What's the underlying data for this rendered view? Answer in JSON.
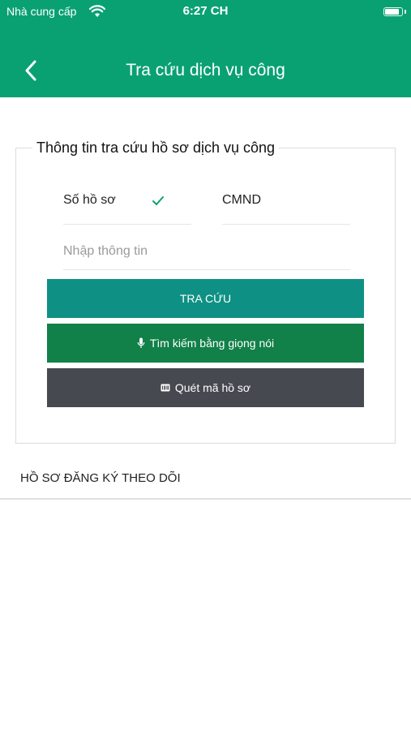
{
  "status_bar": {
    "carrier": "Nhà cung cấp",
    "time": "6:27 CH",
    "battery_level": 0.85
  },
  "header": {
    "title": "Tra cứu dịch vụ công",
    "back_icon": "chevron-left-icon",
    "background_color": "#0aa172"
  },
  "search_card": {
    "legend": "Thông tin tra cứu hồ sơ dịch vụ công",
    "tabs": [
      {
        "label": "Số hồ sơ",
        "selected": true
      },
      {
        "label": "CMND",
        "selected": false
      }
    ],
    "input": {
      "placeholder": "Nhập thông tin",
      "value": ""
    },
    "buttons": {
      "search": {
        "label": "TRA CỨU",
        "color": "#0e9184"
      },
      "voice": {
        "label": "Tìm kiếm bằng giọng nói",
        "icon": "microphone-icon",
        "color": "#118049"
      },
      "scan": {
        "label": "Quét mã hồ sơ",
        "icon": "barcode-icon",
        "color": "#464950"
      }
    }
  },
  "tracked_section": {
    "title": "HỒ SƠ ĐĂNG KÝ THEO DÕI"
  }
}
